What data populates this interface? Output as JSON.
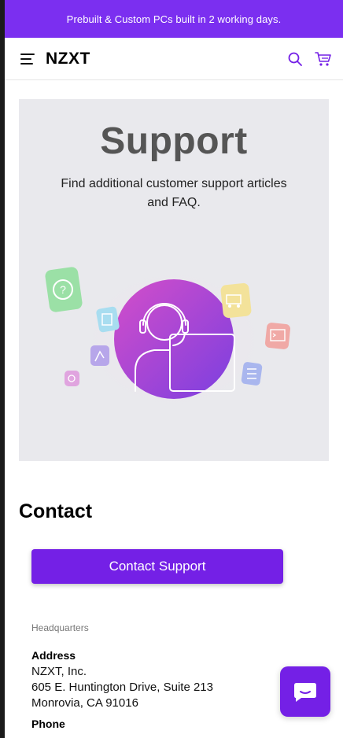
{
  "promo": {
    "text": "Prebuilt & Custom PCs built in 2 working days."
  },
  "header": {
    "logo": "NZXT",
    "icons": [
      "menu-icon",
      "search-icon",
      "cart-icon"
    ]
  },
  "hero": {
    "title": "Support",
    "subtitle": "Find additional customer support articles and FAQ."
  },
  "contact": {
    "heading": "Contact",
    "button_label": "Contact Support",
    "headquarters_label": "Headquarters",
    "address_label": "Address",
    "address_lines": [
      "NZXT, Inc.",
      "605 E. Huntington Drive, Suite 213",
      "Monrovia, CA 91016"
    ],
    "phone_label": "Phone"
  },
  "colors": {
    "brand_purple": "#7420e6",
    "promo_bg": "#7b2ff0",
    "hero_bg": "#e9e9ed"
  },
  "chat": {
    "icon": "chat-icon"
  }
}
